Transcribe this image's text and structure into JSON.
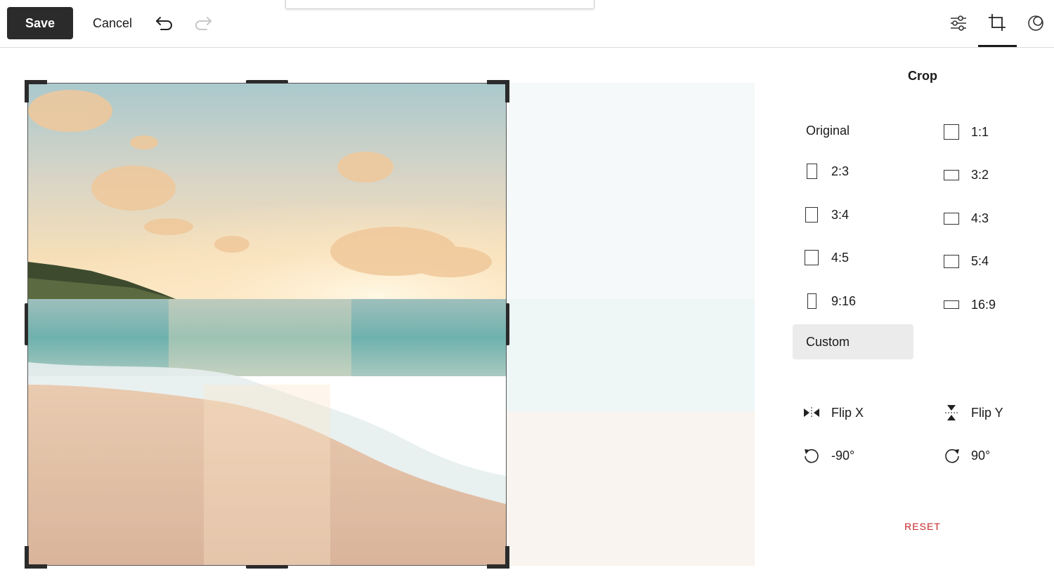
{
  "toolbar": {
    "save_label": "Save",
    "cancel_label": "Cancel",
    "icons": [
      "undo-icon",
      "redo-icon",
      "adjust-sliders-icon",
      "crop-icon",
      "filters-icon"
    ]
  },
  "panel": {
    "title": "Crop",
    "ratios_left": [
      {
        "id": "original",
        "label": "Original"
      },
      {
        "id": "2-3",
        "label": "2:3"
      },
      {
        "id": "3-4",
        "label": "3:4"
      },
      {
        "id": "4-5",
        "label": "4:5"
      },
      {
        "id": "9-16",
        "label": "9:16"
      },
      {
        "id": "custom",
        "label": "Custom"
      }
    ],
    "ratios_right": [
      {
        "id": "1-1",
        "label": "1:1"
      },
      {
        "id": "3-2",
        "label": "3:2"
      },
      {
        "id": "4-3",
        "label": "4:3"
      },
      {
        "id": "5-4",
        "label": "5:4"
      },
      {
        "id": "16-9",
        "label": "16:9"
      }
    ],
    "selected_ratio": "Custom",
    "flip_x_label": "Flip X",
    "flip_y_label": "Flip Y",
    "rotate_left_label": "-90°",
    "rotate_right_label": "90°",
    "reset_label": "RESET"
  },
  "colors": {
    "accent_dark": "#2b2b2b",
    "reset_red": "#c62828",
    "selected_bg": "#ebebeb"
  }
}
